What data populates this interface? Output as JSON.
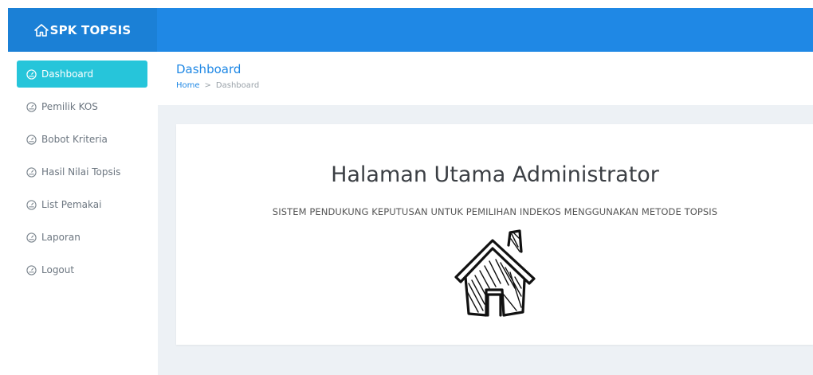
{
  "brand": {
    "title": "SPK TOPSIS",
    "icon": "home-icon"
  },
  "sidebar": {
    "items": [
      {
        "label": "Dashboard",
        "icon": "dashboard-icon",
        "active": true
      },
      {
        "label": "Pemilik KOS",
        "icon": "dashboard-icon"
      },
      {
        "label": "Bobot Kriteria",
        "icon": "dashboard-icon"
      },
      {
        "label": "Hasil Nilai Topsis",
        "icon": "dashboard-icon"
      },
      {
        "label": "List Pemakai",
        "icon": "dashboard-icon"
      },
      {
        "label": "Laporan",
        "icon": "dashboard-icon"
      },
      {
        "label": "Logout",
        "icon": "dashboard-icon"
      }
    ]
  },
  "header": {
    "title": "Dashboard",
    "breadcrumb": {
      "home": "Home",
      "separator": ">",
      "current": "Dashboard"
    }
  },
  "main": {
    "title": "Halaman Utama Administrator",
    "subtitle": "SISTEM PENDUKUNG KEPUTUSAN UNTUK PEMILIHAN INDEKOS MENGGUNAKAN METODE TOPSIS",
    "illustration": "house-sketch-icon"
  },
  "colors": {
    "primary": "#1f88e5",
    "active": "#26c5da",
    "background": "#edf1f5"
  }
}
